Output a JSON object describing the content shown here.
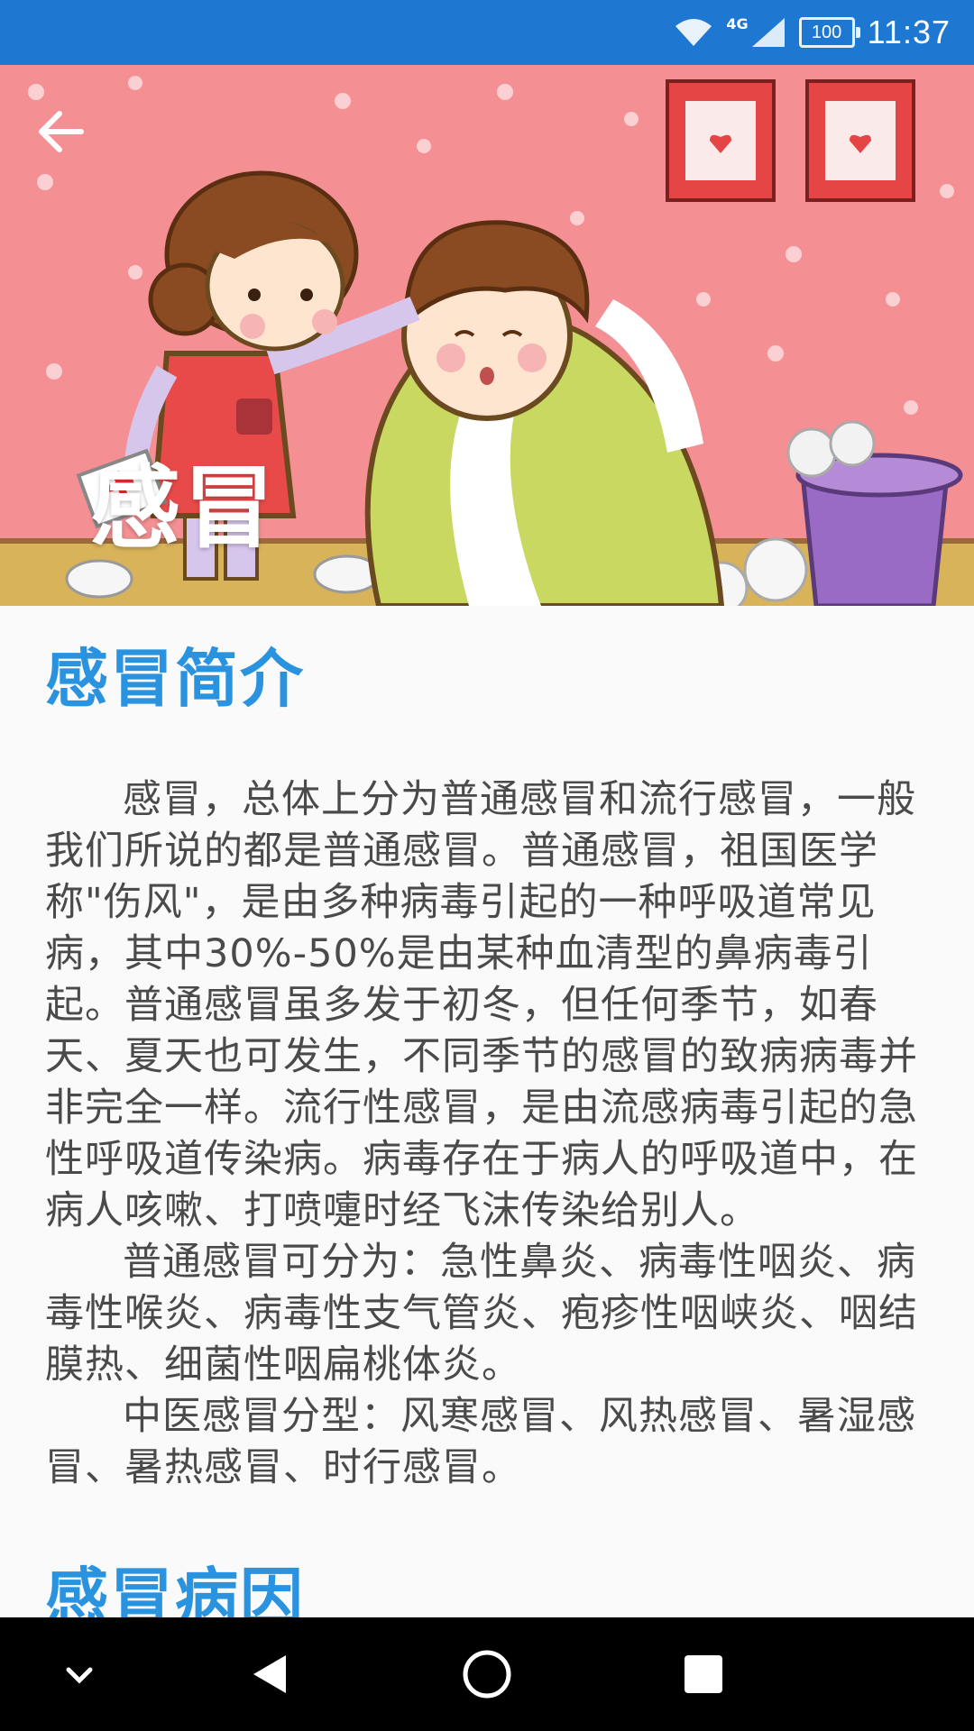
{
  "status_bar": {
    "network": "4G",
    "battery": "100",
    "time": "11:37"
  },
  "header": {
    "title": "感冒",
    "back_icon": "arrow-left-icon"
  },
  "sections": [
    {
      "title": "感冒简介",
      "paragraphs": [
        "感冒，总体上分为普通感冒和流行感冒，一般我们所说的都是普通感冒。普通感冒，祖国医学称\"伤风\"，是由多种病毒引起的一种呼吸道常见病，其中30%-50%是由某种血清型的鼻病毒引起。普通感冒虽多发于初冬，但任何季节，如春天、夏天也可发生，不同季节的感冒的致病病毒并非完全一样。流行性感冒，是由流感病毒引起的急性呼吸道传染病。病毒存在于病人的呼吸道中，在病人咳嗽、打喷嚏时经飞沫传染给别人。",
        "普通感冒可分为：急性鼻炎、病毒性咽炎、病毒性喉炎、病毒性支气管炎、疱疹性咽峡炎、咽结膜热、细菌性咽扁桃体炎。",
        "中医感冒分型：风寒感冒、风热感冒、暑湿感冒、暑热感冒、时行感冒。"
      ]
    },
    {
      "title": "感冒病因"
    }
  ],
  "nav_bar": {
    "icons": [
      "chevron-down-icon",
      "back-triangle-icon",
      "home-circle-icon",
      "recents-square-icon"
    ]
  },
  "colors": {
    "status_bar": "#1e78d2",
    "accent": "#2a93e0",
    "body_text": "#4a4a4a",
    "background": "#fafafa"
  }
}
